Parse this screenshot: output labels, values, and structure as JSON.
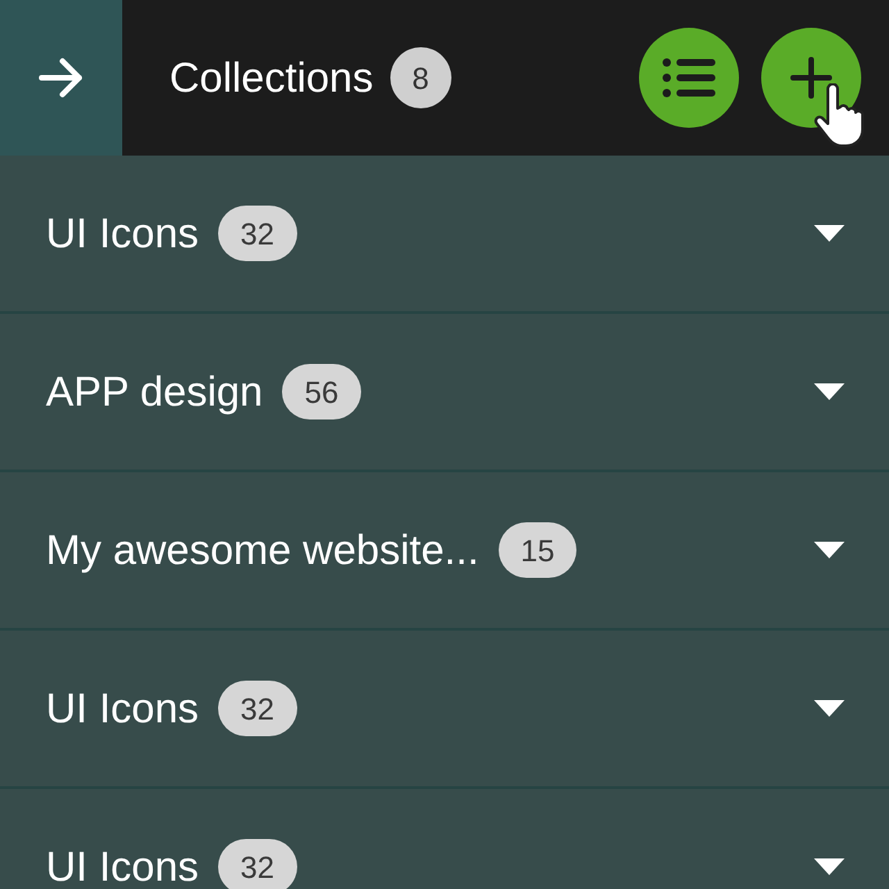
{
  "header": {
    "title": "Collections",
    "count": "8"
  },
  "collections": [
    {
      "name": "UI Icons",
      "count": "32"
    },
    {
      "name": "APP design",
      "count": "56"
    },
    {
      "name": "My awesome website...",
      "count": "15"
    },
    {
      "name": "UI Icons",
      "count": "32"
    },
    {
      "name": "UI Icons",
      "count": "32"
    }
  ]
}
